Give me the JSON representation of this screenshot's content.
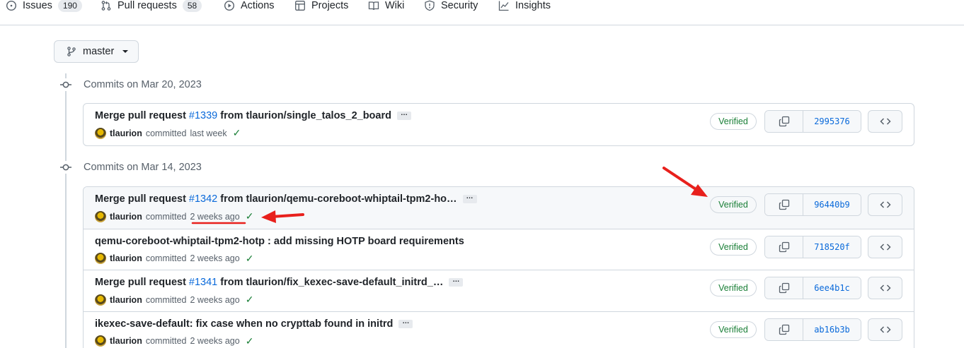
{
  "nav": {
    "items": [
      {
        "label": "Issues",
        "count": "190",
        "icon": "issue-icon"
      },
      {
        "label": "Pull requests",
        "count": "58",
        "icon": "pull-request-icon"
      },
      {
        "label": "Actions",
        "icon": "play-icon"
      },
      {
        "label": "Projects",
        "icon": "table-icon"
      },
      {
        "label": "Wiki",
        "icon": "book-icon"
      },
      {
        "label": "Security",
        "icon": "shield-icon"
      },
      {
        "label": "Insights",
        "icon": "graph-icon"
      }
    ]
  },
  "branch": {
    "name": "master"
  },
  "groups": [
    {
      "title": "Commits on Mar 20, 2023",
      "commits": [
        {
          "prefix": "Merge pull request",
          "pr": "#1339",
          "suffix": "from tlaurion/single_talos_2_board",
          "author": "tlaurion",
          "committed": "committed",
          "when": "last week",
          "verified": "Verified",
          "sha": "2995376"
        }
      ]
    },
    {
      "title": "Commits on Mar 14, 2023",
      "commits": [
        {
          "prefix": "Merge pull request",
          "pr": "#1342",
          "suffix": "from tlaurion/qemu-coreboot-whiptail-tpm2-ho…",
          "author": "tlaurion",
          "committed": "committed",
          "when": "2 weeks ago",
          "verified": "Verified",
          "sha": "96440b9"
        },
        {
          "prefix": "qemu-coreboot-whiptail-tpm2-hotp : add missing HOTP board requirements",
          "pr": "",
          "suffix": "",
          "author": "tlaurion",
          "committed": "committed",
          "when": "2 weeks ago",
          "verified": "Verified",
          "sha": "718520f"
        },
        {
          "prefix": "Merge pull request",
          "pr": "#1341",
          "suffix": "from tlaurion/fix_kexec-save-default_initrd_…",
          "author": "tlaurion",
          "committed": "committed",
          "when": "2 weeks ago",
          "verified": "Verified",
          "sha": "6ee4b1c"
        },
        {
          "prefix": "ikexec-save-default: fix case when no crypttab found in initrd",
          "pr": "",
          "suffix": "",
          "author": "tlaurion",
          "committed": "committed",
          "when": "2 weeks ago",
          "verified": "Verified",
          "sha": "ab16b3b"
        }
      ]
    }
  ],
  "colors": {
    "accent": "#0969da",
    "success": "#1a7f37",
    "annotation": "#e8201c"
  }
}
